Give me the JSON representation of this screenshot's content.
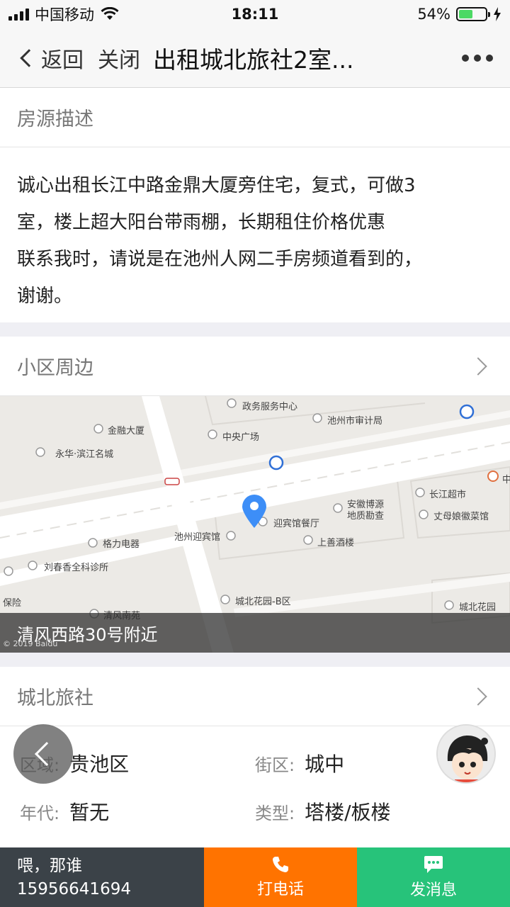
{
  "status_bar": {
    "carrier": "中国移动",
    "time": "18:11",
    "battery_percent": "54%",
    "battery_level": 0.54,
    "signal_icon": "signal-bars-icon",
    "wifi_icon": "wifi-icon",
    "charging_icon": "bolt-icon"
  },
  "nav": {
    "back_label": "返回",
    "close_label": "关闭",
    "title": "出租城北旅社2室..."
  },
  "description": {
    "header": "房源描述",
    "lines": [
      "诚心出租长江中路金鼎大厦旁住宅，复式，可做3",
      "室，楼上超大阳台带雨棚，长期租住价格优惠",
      "联系我时，请说是在池州人网二手房频道看到的，",
      "谢谢。"
    ]
  },
  "surroundings": {
    "header": "小区周边"
  },
  "map": {
    "caption": "清风西路30号附近",
    "copyright": "© 2019 Baidu",
    "pois": [
      "政务服务中心",
      "池州市审计局",
      "金融大厦",
      "中央广场",
      "永华·滨江名城",
      "中",
      "长江超市",
      "安徽博源地质勘查",
      "丈母娘徽菜馆",
      "迎宾馆餐厅",
      "池州迎宾馆",
      "上善酒楼",
      "格力电器",
      "刘春香全科诊所",
      "保险",
      "城北花园-B区",
      "城北花园",
      "清风南苑"
    ]
  },
  "community": {
    "header": "城北旅社",
    "fields": [
      {
        "key": "区域:",
        "value": "贵池区"
      },
      {
        "key": "街区:",
        "value": "城中"
      },
      {
        "key": "年代:",
        "value": "暂无"
      },
      {
        "key": "类型:",
        "value": "塔楼/板楼"
      }
    ]
  },
  "bottom_bar": {
    "contact_name": "喂，那谁",
    "contact_phone": "15956641694",
    "call_label": "打电话",
    "message_label": "发消息"
  },
  "colors": {
    "call": "#ff7300",
    "message": "#27c37a",
    "contact_bg": "#3b4248",
    "map_pin": "#3d8ef7"
  }
}
